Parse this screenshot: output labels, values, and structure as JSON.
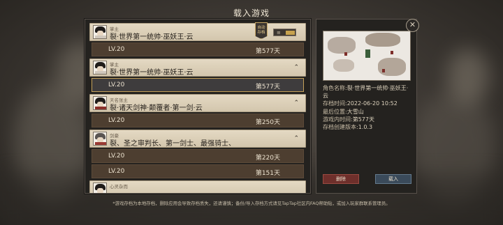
{
  "screen": {
    "title": "载入游戏"
  },
  "saves": [
    {
      "subtitle": "掌主",
      "name": "裂·世界第一统帅·巫妖王·云",
      "badge": "自动\n存档",
      "expanded": false,
      "entries": [
        {
          "level": "LV.20",
          "days": "第577天",
          "selected": false
        }
      ]
    },
    {
      "subtitle": "掌主",
      "name": "裂·世界第一统帅·巫妖王·云",
      "expanded": true,
      "entries": [
        {
          "level": "LV.20",
          "days": "第577天",
          "selected": true
        }
      ]
    },
    {
      "subtitle": "天名张主",
      "name": "裂·诸天剑神·颠覆者·第一剑·云",
      "expanded": true,
      "entries": [
        {
          "level": "LV.20",
          "days": "第250天",
          "selected": false
        }
      ]
    },
    {
      "subtitle": "剑豪",
      "name": "裂、圣之审判长、第一剑士、最强骑士、",
      "expanded": true,
      "entries": [
        {
          "level": "LV.20",
          "days": "第220天",
          "selected": false
        },
        {
          "level": "LV.20",
          "days": "第151天",
          "selected": false
        }
      ]
    },
    {
      "subtitle": "心灵杂而",
      "name": "",
      "expanded": false,
      "entries": []
    }
  ],
  "detail": {
    "character_name_label": "角色名称:",
    "character_name": "裂·世界第一统帅·巫妖王·云",
    "save_time_label": "存档时间:",
    "save_time": "2022-06-20 10:52",
    "last_location_label": "最后位置:",
    "last_location": "大雪山",
    "game_time_label": "游戏内时间:",
    "game_time": "第577天",
    "version_label": "存档创建版本:",
    "version": "1.0.3",
    "delete_label": "删除",
    "load_label": "载入",
    "close_label": "✕"
  },
  "footer": {
    "note": "*游戏存档为本地存档，删除应用会导致存档丢失，还请谨慎；备份/导入存档方式请见TapTap社区内FAQ帮助贴，或加入玩家群联系管理员。"
  },
  "icons": {
    "chevron_up": "⌃",
    "chevron_down": "⌄",
    "close": "close-icon",
    "portrait": "portrait-icon"
  },
  "colors": {
    "accent_gold": "#c4a15a",
    "delete_red": "#6e2f2b",
    "load_blue": "#3a4a5a"
  }
}
